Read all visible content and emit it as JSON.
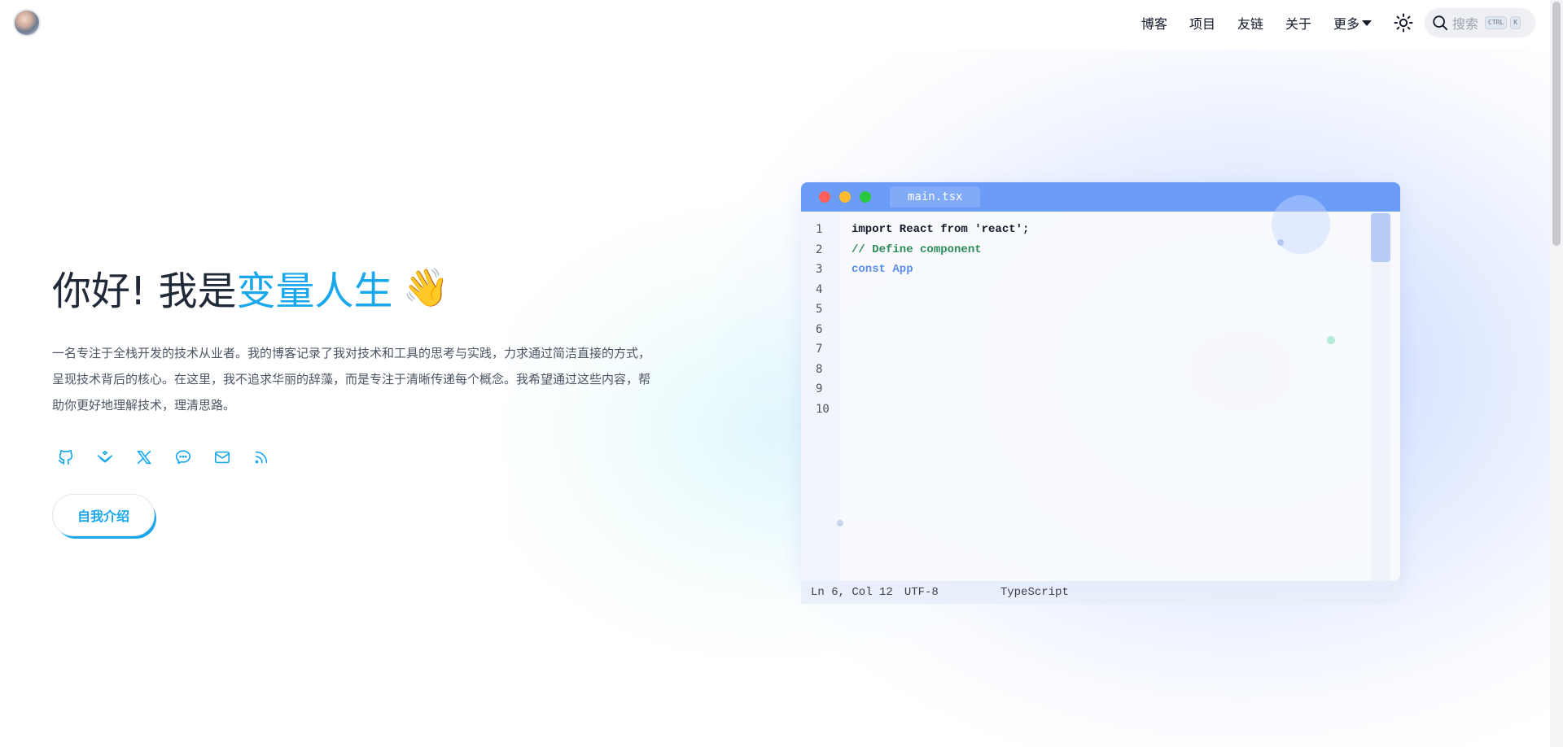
{
  "header": {
    "avatar_alt": "avatar",
    "nav": [
      {
        "label": "博客"
      },
      {
        "label": "项目"
      },
      {
        "label": "友链"
      },
      {
        "label": "关于"
      },
      {
        "label": "更多"
      }
    ],
    "search": {
      "placeholder": "搜索",
      "kbd_ctrl": "CTRL",
      "kbd_k": "K"
    }
  },
  "hero": {
    "greeting": "你好! 我是",
    "name": "变量人生",
    "wave": "👋",
    "description": "一名专注于全栈开发的技术从业者。我的博客记录了我对技术和工具的思考与实践，力求通过简洁直接的方式，呈现技术背后的核心。在这里，我不追求华丽的辞藻，而是专注于清晰传递每个概念。我希望通过这些内容，帮助你更好地理解技术，理清思路。",
    "socials": [
      "github-icon",
      "juejin-icon",
      "x-icon",
      "wechat-icon",
      "mail-icon",
      "rss-icon"
    ],
    "intro_button": "自我介绍"
  },
  "editor": {
    "tab": "main.tsx",
    "line_numbers": [
      "1",
      "2",
      "3",
      "4",
      "5",
      "6",
      "7",
      "8",
      "9",
      "10"
    ],
    "lines": [
      {
        "text": "import React from 'react';",
        "kind": "plain"
      },
      {
        "text": "// Define component",
        "kind": "comment"
      },
      {
        "text": "const App ",
        "kind": "keyword"
      }
    ],
    "status": {
      "position": "Ln 6, Col 12",
      "encoding": "UTF-8",
      "language": "TypeScript"
    }
  },
  "colors": {
    "accent": "#1aa7ec",
    "titlebar": "#6b9cf7",
    "comment": "#2e8b57",
    "keyword": "#5a8ee8"
  }
}
